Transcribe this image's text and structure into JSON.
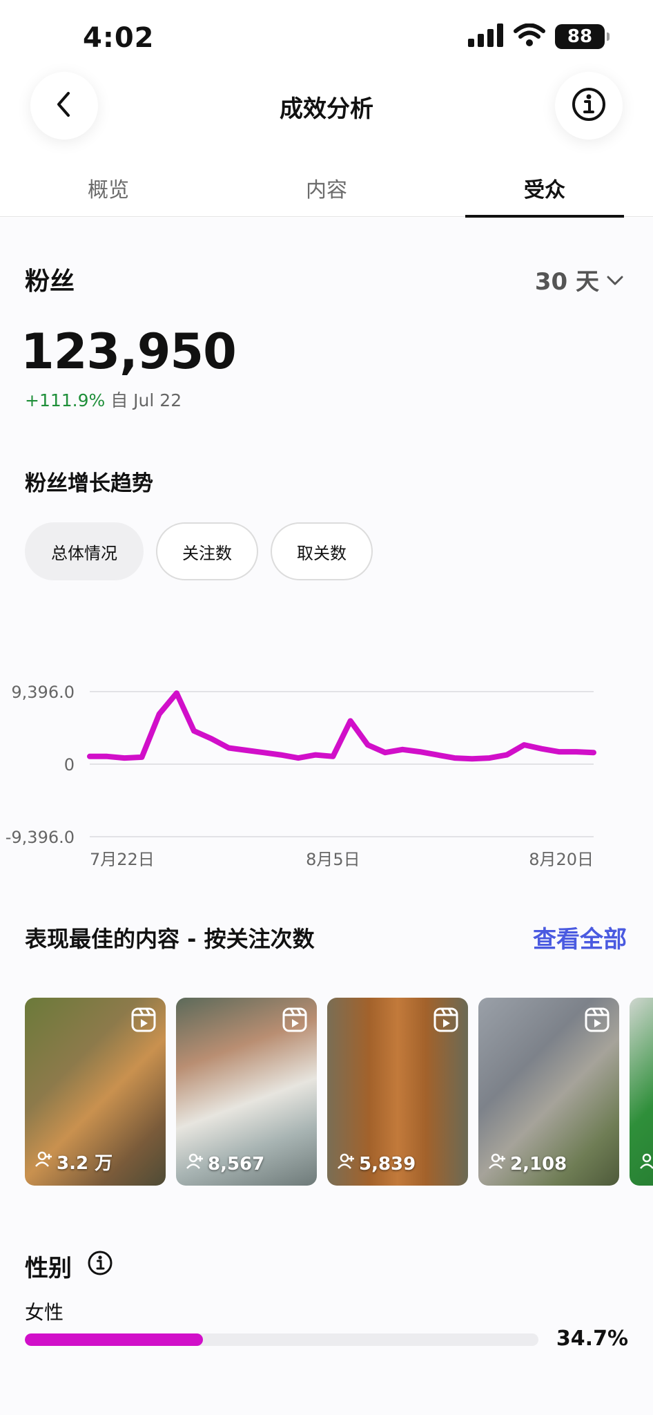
{
  "status": {
    "time": "4:02",
    "battery": "88"
  },
  "nav": {
    "title": "成效分析"
  },
  "tabs": [
    {
      "label": "概览"
    },
    {
      "label": "内容"
    },
    {
      "label": "受众"
    }
  ],
  "followers": {
    "title": "粉丝",
    "period": "30 天",
    "total": "123,950",
    "change": "+111.9%",
    "since": "自 Jul 22"
  },
  "growth": {
    "title": "粉丝增长趋势",
    "chips": [
      {
        "label": "总体情况"
      },
      {
        "label": "关注数"
      },
      {
        "label": "取关数"
      }
    ]
  },
  "chart_data": {
    "type": "line",
    "color": "#d10fc9",
    "ylim": [
      -9396,
      9396
    ],
    "y_ticks": [
      "9,396.0",
      "0",
      "-9,396.0"
    ],
    "x_ticks": [
      "7月22日",
      "8月5日",
      "8月20日"
    ],
    "grid": true,
    "series": [
      {
        "values": [
          1000,
          1000,
          800,
          900,
          6500,
          9200,
          4300,
          3300,
          2100,
          1800,
          1500,
          1200,
          800,
          1200,
          1000,
          5600,
          2500,
          1500,
          1900,
          1600,
          1200,
          800,
          700,
          800,
          1200,
          2500,
          2000,
          1600,
          1600,
          1500
        ]
      }
    ]
  },
  "top_content": {
    "title": "表现最佳的内容 - 按关注次数",
    "view_all": "查看全部",
    "items": [
      {
        "count": "3.2 万"
      },
      {
        "count": "8,567"
      },
      {
        "count": "5,839"
      },
      {
        "count": "2,108"
      },
      {
        "count": ""
      }
    ]
  },
  "gender": {
    "title": "性别",
    "female_label": "女性",
    "female_percent": "34.7%",
    "female_fraction": 0.347
  }
}
